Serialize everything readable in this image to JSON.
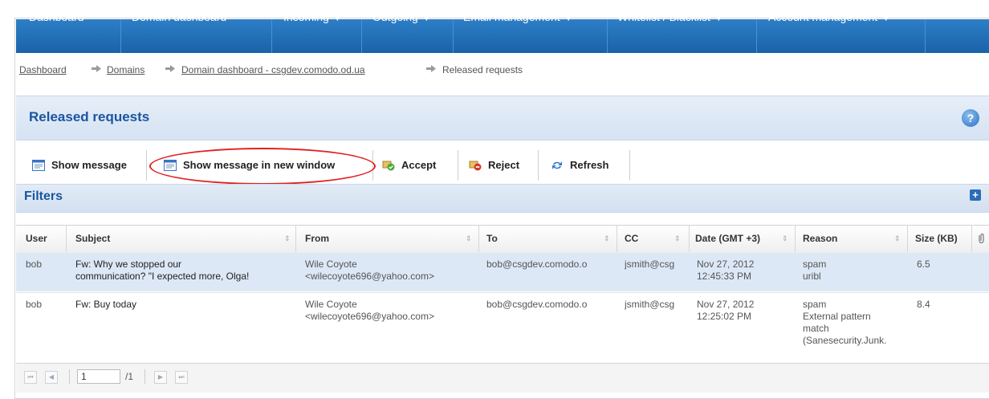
{
  "nav": {
    "items": [
      {
        "label": "Dashboard",
        "dropdown": false
      },
      {
        "label": "Domain dashboard",
        "dropdown": false
      },
      {
        "label": "Incoming",
        "dropdown": true
      },
      {
        "label": "Outgoing",
        "dropdown": true
      },
      {
        "label": "Email management",
        "dropdown": true
      },
      {
        "label": "Whitelist / Blacklist",
        "dropdown": true
      },
      {
        "label": "Account management",
        "dropdown": true
      }
    ],
    "caret": "▼"
  },
  "breadcrumb": {
    "items": [
      "Dashboard",
      "Domains",
      "Domain dashboard - csgdev.comodo.od.ua",
      "Released requests"
    ]
  },
  "page": {
    "title": "Released requests",
    "help": "?"
  },
  "toolbar": {
    "show_message": "Show message",
    "show_message_new_window": "Show message in new window",
    "accept": "Accept",
    "reject": "Reject",
    "refresh": "Refresh"
  },
  "filters": {
    "title": "Filters",
    "expand": "+"
  },
  "table": {
    "columns": [
      "User",
      "Subject",
      "From",
      "To",
      "CC",
      "Date (GMT +3)",
      "Reason",
      "Size (KB)"
    ],
    "sort_glyph": "⇕",
    "rows": [
      {
        "user": "bob",
        "subject": [
          "Fw: Why we stopped our",
          "communication? \"I expected more, Olga!"
        ],
        "from": [
          "Wile Coyote",
          "<wilecoyote696@yahoo.com>"
        ],
        "to": "bob@csgdev.comodo.o",
        "cc": "jsmith@csg",
        "date": [
          "Nov 27, 2012",
          "12:45:33 PM"
        ],
        "reason": [
          "spam",
          "uribl"
        ],
        "size": "6.5",
        "selected": true
      },
      {
        "user": "bob",
        "subject": [
          "Fw: Buy today"
        ],
        "from": [
          "Wile Coyote",
          "<wilecoyote696@yahoo.com>"
        ],
        "to": "bob@csgdev.comodo.o",
        "cc": "jsmith@csg",
        "date": [
          "Nov 27, 2012",
          "12:25:02 PM"
        ],
        "reason": [
          "spam",
          "External pattern",
          "match",
          "(Sanesecurity.Junk."
        ],
        "size": "8.4",
        "selected": false
      }
    ]
  },
  "pager": {
    "page": "1",
    "of": "/1",
    "first": "⏮",
    "prev": "◀",
    "next": "▶",
    "last": "⏭"
  },
  "colors": {
    "nav": "#1a62a8",
    "title": "#1a56a0",
    "selected_row": "#dce8f6",
    "highlight": "#e02020"
  }
}
